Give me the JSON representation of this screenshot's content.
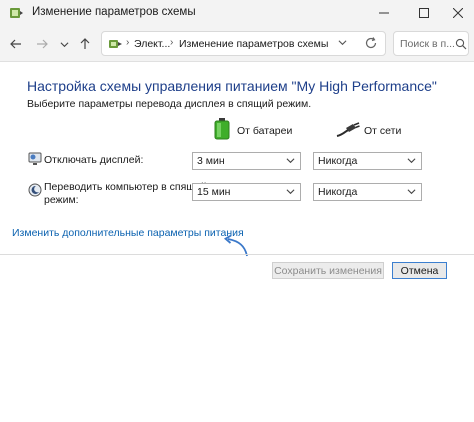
{
  "window": {
    "title": "Изменение параметров схемы",
    "minimize_icon": "minimize-icon",
    "maximize_icon": "maximize-icon",
    "close_icon": "close-icon"
  },
  "navigation": {
    "breadcrumb": [
      "Элект...",
      "Изменение параметров схемы"
    ],
    "search_placeholder": "Поиск в п..."
  },
  "main": {
    "heading": "Настройка схемы управления питанием \"My High Performance\"",
    "subheading": "Выберите параметры перевода дисплея в спящий режим.",
    "columns": {
      "battery_label": "От батареи",
      "plugged_label": "От сети"
    },
    "rows": [
      {
        "label": "Отключать дисплей:",
        "battery_value": "3 мин",
        "plugged_value": "Никогда"
      },
      {
        "label_line1": "Переводить компьютер в спящий",
        "label_line2": "режим:",
        "battery_value": "15 мин",
        "plugged_value": "Никогда"
      }
    ],
    "advanced_link": "Изменить дополнительные параметры питания"
  },
  "footer": {
    "save_label": "Сохранить изменения",
    "cancel_label": "Отмена"
  },
  "colors": {
    "heading": "#1e3f8a",
    "link": "#0b62b0",
    "arrow": "#3a78c9",
    "battery": "#3fae2a"
  }
}
